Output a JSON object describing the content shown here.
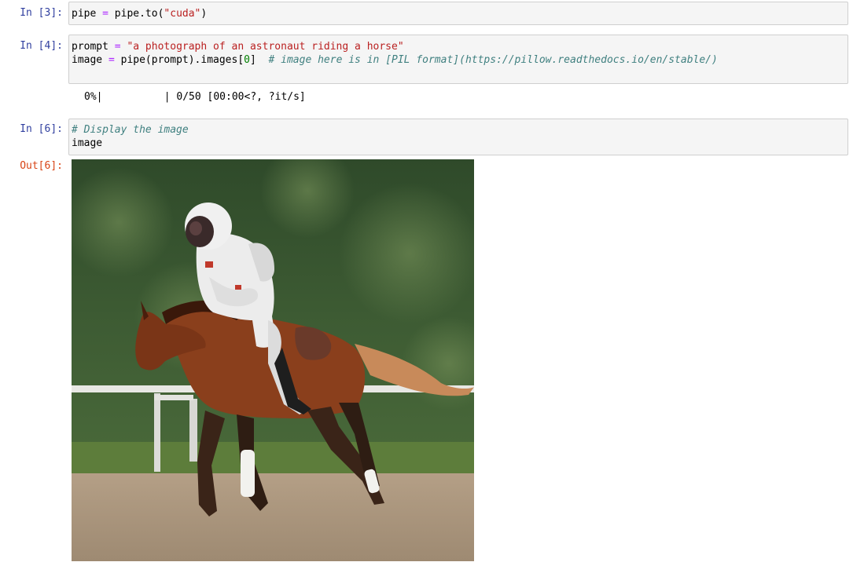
{
  "cells": [
    {
      "prompt": "In [3]:",
      "lines": [
        {
          "a": "pipe ",
          "op": "=",
          "b": " pipe.to(",
          "str": "\"cuda\"",
          "c": ")"
        }
      ]
    },
    {
      "prompt": "In [4]:",
      "line1": {
        "a": "prompt ",
        "op": "=",
        "str": " \"a photograph of an astronaut riding a horse\""
      },
      "line2": {
        "a": "image ",
        "op": "=",
        "b": " pipe(prompt).images[",
        "num": "0",
        "c": "]  ",
        "comment": "# image here is in [PIL format](https://pillow.readthedocs.io/en/stable/)"
      }
    },
    {
      "prompt": "In [6]:",
      "comment": "# Display the image",
      "code": "image"
    }
  ],
  "progress": "0%|          | 0/50 [00:00<?, ?it/s]",
  "output": {
    "prompt": "Out[6]:",
    "image_description": "astronaut-riding-horse-image"
  },
  "colors": {
    "in_prompt": "#303f9f",
    "out_prompt": "#d84315",
    "cell_bg": "#f5f5f5",
    "cell_border": "#cfcfcf"
  }
}
